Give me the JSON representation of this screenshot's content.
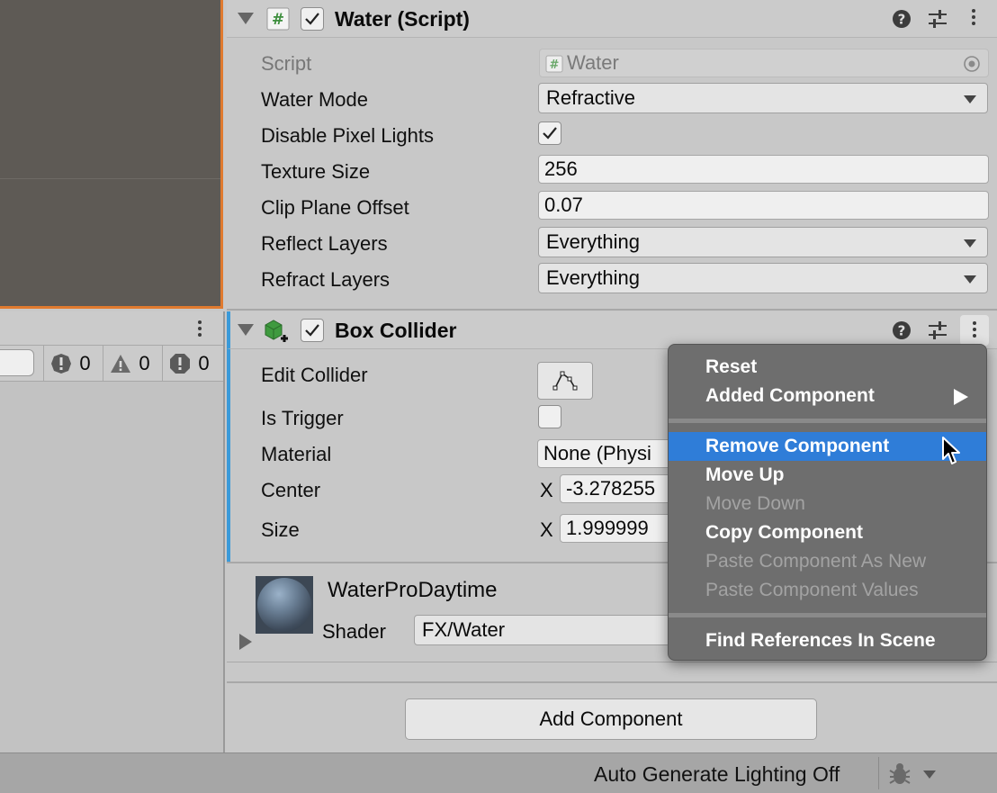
{
  "water_component": {
    "title": "Water (Script)",
    "enabled": true,
    "properties": {
      "script_label": "Script",
      "script_value": "Water",
      "water_mode_label": "Water Mode",
      "water_mode_value": "Refractive",
      "disable_pixel_lights_label": "Disable Pixel Lights",
      "disable_pixel_lights_checked": true,
      "texture_size_label": "Texture Size",
      "texture_size_value": "256",
      "clip_plane_offset_label": "Clip Plane Offset",
      "clip_plane_offset_value": "0.07",
      "reflect_layers_label": "Reflect Layers",
      "reflect_layers_value": "Everything",
      "refract_layers_label": "Refract Layers",
      "refract_layers_value": "Everything"
    }
  },
  "box_collider": {
    "title": "Box Collider",
    "enabled": true,
    "properties": {
      "edit_collider_label": "Edit Collider",
      "is_trigger_label": "Is Trigger",
      "is_trigger_checked": false,
      "material_label": "Material",
      "material_value": "None (Physi",
      "center_label": "Center",
      "center_x_label": "X",
      "center_x_value": "-3.278255",
      "size_label": "Size",
      "size_x_label": "X",
      "size_x_value": "1.999999"
    }
  },
  "material": {
    "name": "WaterProDaytime",
    "shader_label": "Shader",
    "shader_value": "FX/Water"
  },
  "add_component_label": "Add Component",
  "console": {
    "error_count": "0",
    "warning_count": "0",
    "info_count": "0"
  },
  "status_bar": {
    "text": "Auto Generate Lighting Off"
  },
  "context_menu": {
    "items": [
      {
        "label": "Reset",
        "enabled": true
      },
      {
        "label": "Added Component",
        "enabled": true,
        "submenu": true
      },
      {
        "label": "Remove Component",
        "enabled": true,
        "highlighted": true
      },
      {
        "label": "Move Up",
        "enabled": true
      },
      {
        "label": "Move Down",
        "enabled": false
      },
      {
        "label": "Copy Component",
        "enabled": true
      },
      {
        "label": "Paste Component As New",
        "enabled": false
      },
      {
        "label": "Paste Component Values",
        "enabled": false
      },
      {
        "label": "Find References In Scene",
        "enabled": true
      }
    ]
  },
  "colors": {
    "scene_background": "#5e5a55",
    "scene_selection_border": "#e07a2f",
    "inspector_background": "#c8c8c8",
    "menu_background": "#6e6e6e",
    "menu_highlight": "#2f7dd8",
    "collider_accent": "#3a9ad9",
    "script_icon_green": "#3e8f3e"
  },
  "icons": [
    "hash-script-icon",
    "checkmark-icon",
    "help-icon",
    "preset-sliders-icon",
    "kebab-menu-icon",
    "box-collider-icon",
    "edit-collider-icon",
    "object-picker-icon",
    "error-icon",
    "warning-icon",
    "info-icon",
    "bug-icon",
    "mouse-cursor-icon",
    "submenu-arrow-icon",
    "foldout-arrow-icon"
  ]
}
